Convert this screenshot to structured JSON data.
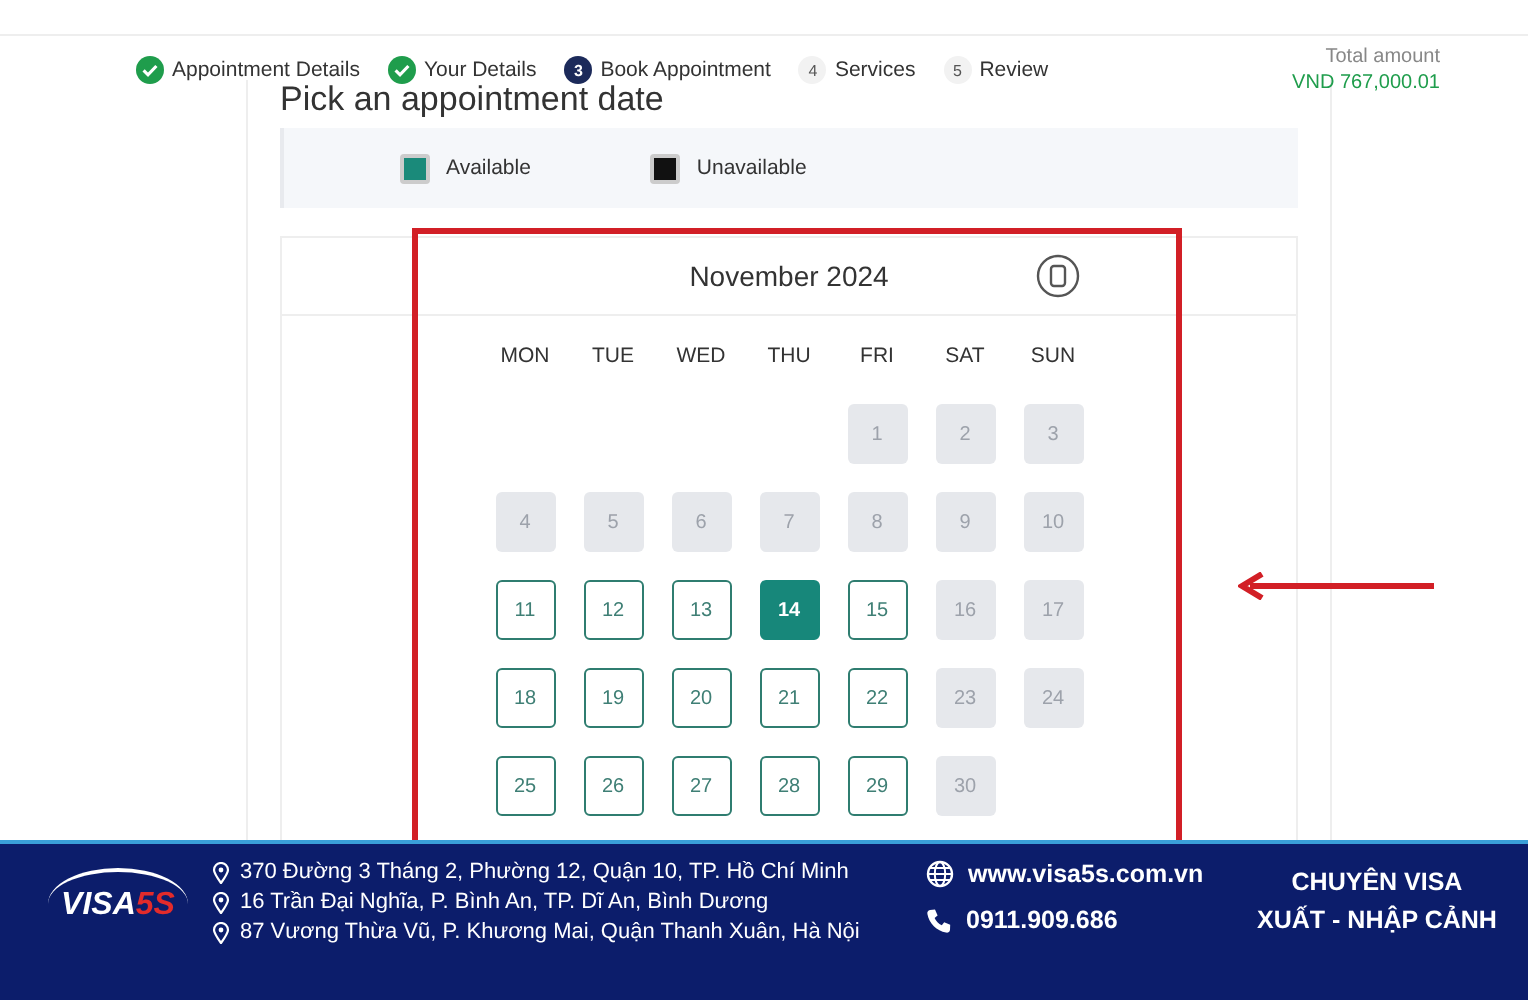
{
  "steps": [
    {
      "label": "Appointment Details",
      "completed": true,
      "selected": false
    },
    {
      "label": "Your Details",
      "completed": true,
      "selected": false
    },
    {
      "label": "Book Appointment",
      "number": "3",
      "completed": false,
      "selected": true
    },
    {
      "label": "Services",
      "number": "4",
      "completed": false,
      "selected": false
    },
    {
      "label": "Review",
      "number": "5",
      "completed": false,
      "selected": false
    }
  ],
  "total": {
    "label": "Total amount",
    "value": "VND 767,000.01"
  },
  "page_title": "Pick an appointment date",
  "legend": [
    {
      "label": "Available",
      "color": "#1a8a7a"
    },
    {
      "label": "Unavailable",
      "color": "#111111"
    }
  ],
  "calendar": {
    "month": "November 2024",
    "weekdays": [
      "MON",
      "TUE",
      "WED",
      "THU",
      "FRI",
      "SAT",
      "SUN"
    ],
    "weeks": [
      [
        {
          "kind": "empty"
        },
        {
          "kind": "empty"
        },
        {
          "kind": "empty"
        },
        {
          "kind": "empty"
        },
        {
          "label": "1",
          "available": false,
          "selected": false
        },
        {
          "label": "2",
          "available": false,
          "selected": false
        },
        {
          "label": "3",
          "available": false,
          "selected": false
        }
      ],
      [
        {
          "label": "4",
          "available": false,
          "selected": false
        },
        {
          "label": "5",
          "available": false,
          "selected": false
        },
        {
          "label": "6",
          "available": false,
          "selected": false
        },
        {
          "label": "7",
          "available": false,
          "selected": false
        },
        {
          "label": "8",
          "available": false,
          "selected": false
        },
        {
          "label": "9",
          "available": false,
          "selected": false
        },
        {
          "label": "10",
          "available": false,
          "selected": false
        }
      ],
      [
        {
          "label": "11",
          "available": true,
          "selected": false
        },
        {
          "label": "12",
          "available": true,
          "selected": false
        },
        {
          "label": "13",
          "available": true,
          "selected": false
        },
        {
          "label": "14",
          "available": true,
          "selected": true
        },
        {
          "label": "15",
          "available": true,
          "selected": false
        },
        {
          "label": "16",
          "available": false,
          "selected": false
        },
        {
          "label": "17",
          "available": false,
          "selected": false
        }
      ],
      [
        {
          "label": "18",
          "available": true,
          "selected": false
        },
        {
          "label": "19",
          "available": true,
          "selected": false
        },
        {
          "label": "20",
          "available": true,
          "selected": false
        },
        {
          "label": "21",
          "available": true,
          "selected": false
        },
        {
          "label": "22",
          "available": true,
          "selected": false
        },
        {
          "label": "23",
          "available": false,
          "selected": false
        },
        {
          "label": "24",
          "available": false,
          "selected": false
        }
      ],
      [
        {
          "label": "25",
          "available": true,
          "selected": false
        },
        {
          "label": "26",
          "available": true,
          "selected": false
        },
        {
          "label": "27",
          "available": true,
          "selected": false
        },
        {
          "label": "28",
          "available": true,
          "selected": false
        },
        {
          "label": "29",
          "available": true,
          "selected": false
        },
        {
          "label": "30",
          "available": false,
          "selected": false
        }
      ]
    ]
  },
  "banner": {
    "logo": {
      "main": "VISA",
      "accent": "5S"
    },
    "addresses": [
      "370 Đường 3 Tháng 2, Phường 12, Quận 10, TP. Hồ Chí Minh",
      "16 Trần Đại Nghĩa, P. Bình An, TP. Dĩ An, Bình Dương",
      "87 Vương Thừa Vũ, P. Khương Mai, Quận Thanh Xuân, Hà Nội"
    ],
    "website": "www.visa5s.com.vn",
    "phone": "0911.909.686",
    "slogan": [
      "CHUYÊN VISA",
      "XUẤT - NHẬP CẢNH"
    ]
  }
}
